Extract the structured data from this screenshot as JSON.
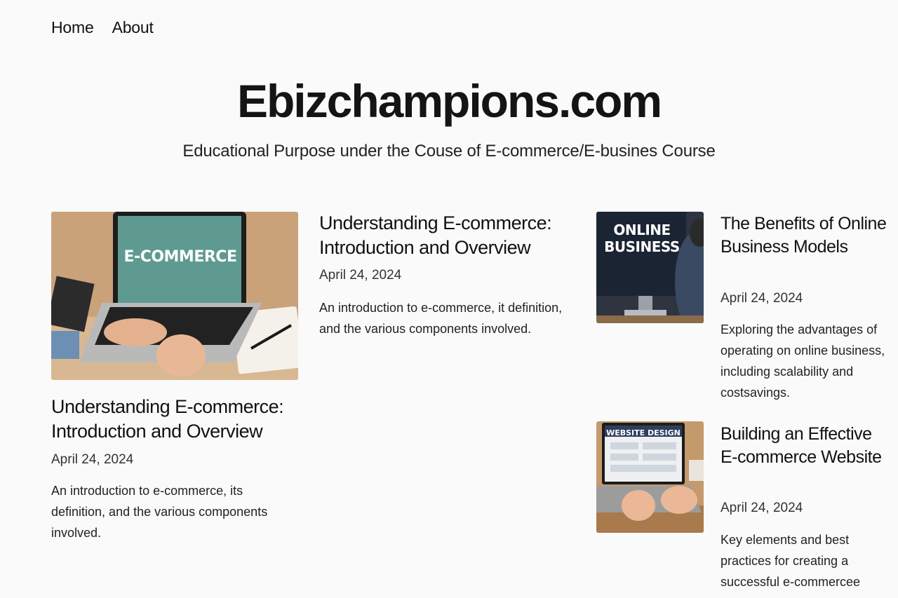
{
  "nav": {
    "items": [
      "Home",
      "About"
    ]
  },
  "site": {
    "title": "Ebizchampions.com",
    "tagline": "Educational Purpose under the Couse of E-commerce/E-busines Course"
  },
  "featured_post": {
    "image_text": "E-COMMERCE",
    "title": "Understanding E-commerce: Introduction and Overview",
    "date": "April 24, 2024",
    "excerpt": "An introduction to e-commerce, its definition, and the various components involved."
  },
  "middle_post": {
    "title": "Understanding E-commerce: Introduction and Overview",
    "date": "April 24, 2024",
    "excerpt": "An introduction to e-commerce, it definition, and the various components involved."
  },
  "side_posts": [
    {
      "image_text_1": "ONLINE",
      "image_text_2": "BUSINESS",
      "title": "The Benefits of Online Business Models",
      "date": "April 24, 2024",
      "excerpt": "Exploring the advantages of operating on online business, including scalability and costsavings."
    },
    {
      "image_text": "WEBSITE DESIGN",
      "title": "Building an Effective E-commerce Website",
      "date": "April 24, 2024",
      "excerpt": "Key elements and best practices for creating a successful e-commercee"
    }
  ]
}
